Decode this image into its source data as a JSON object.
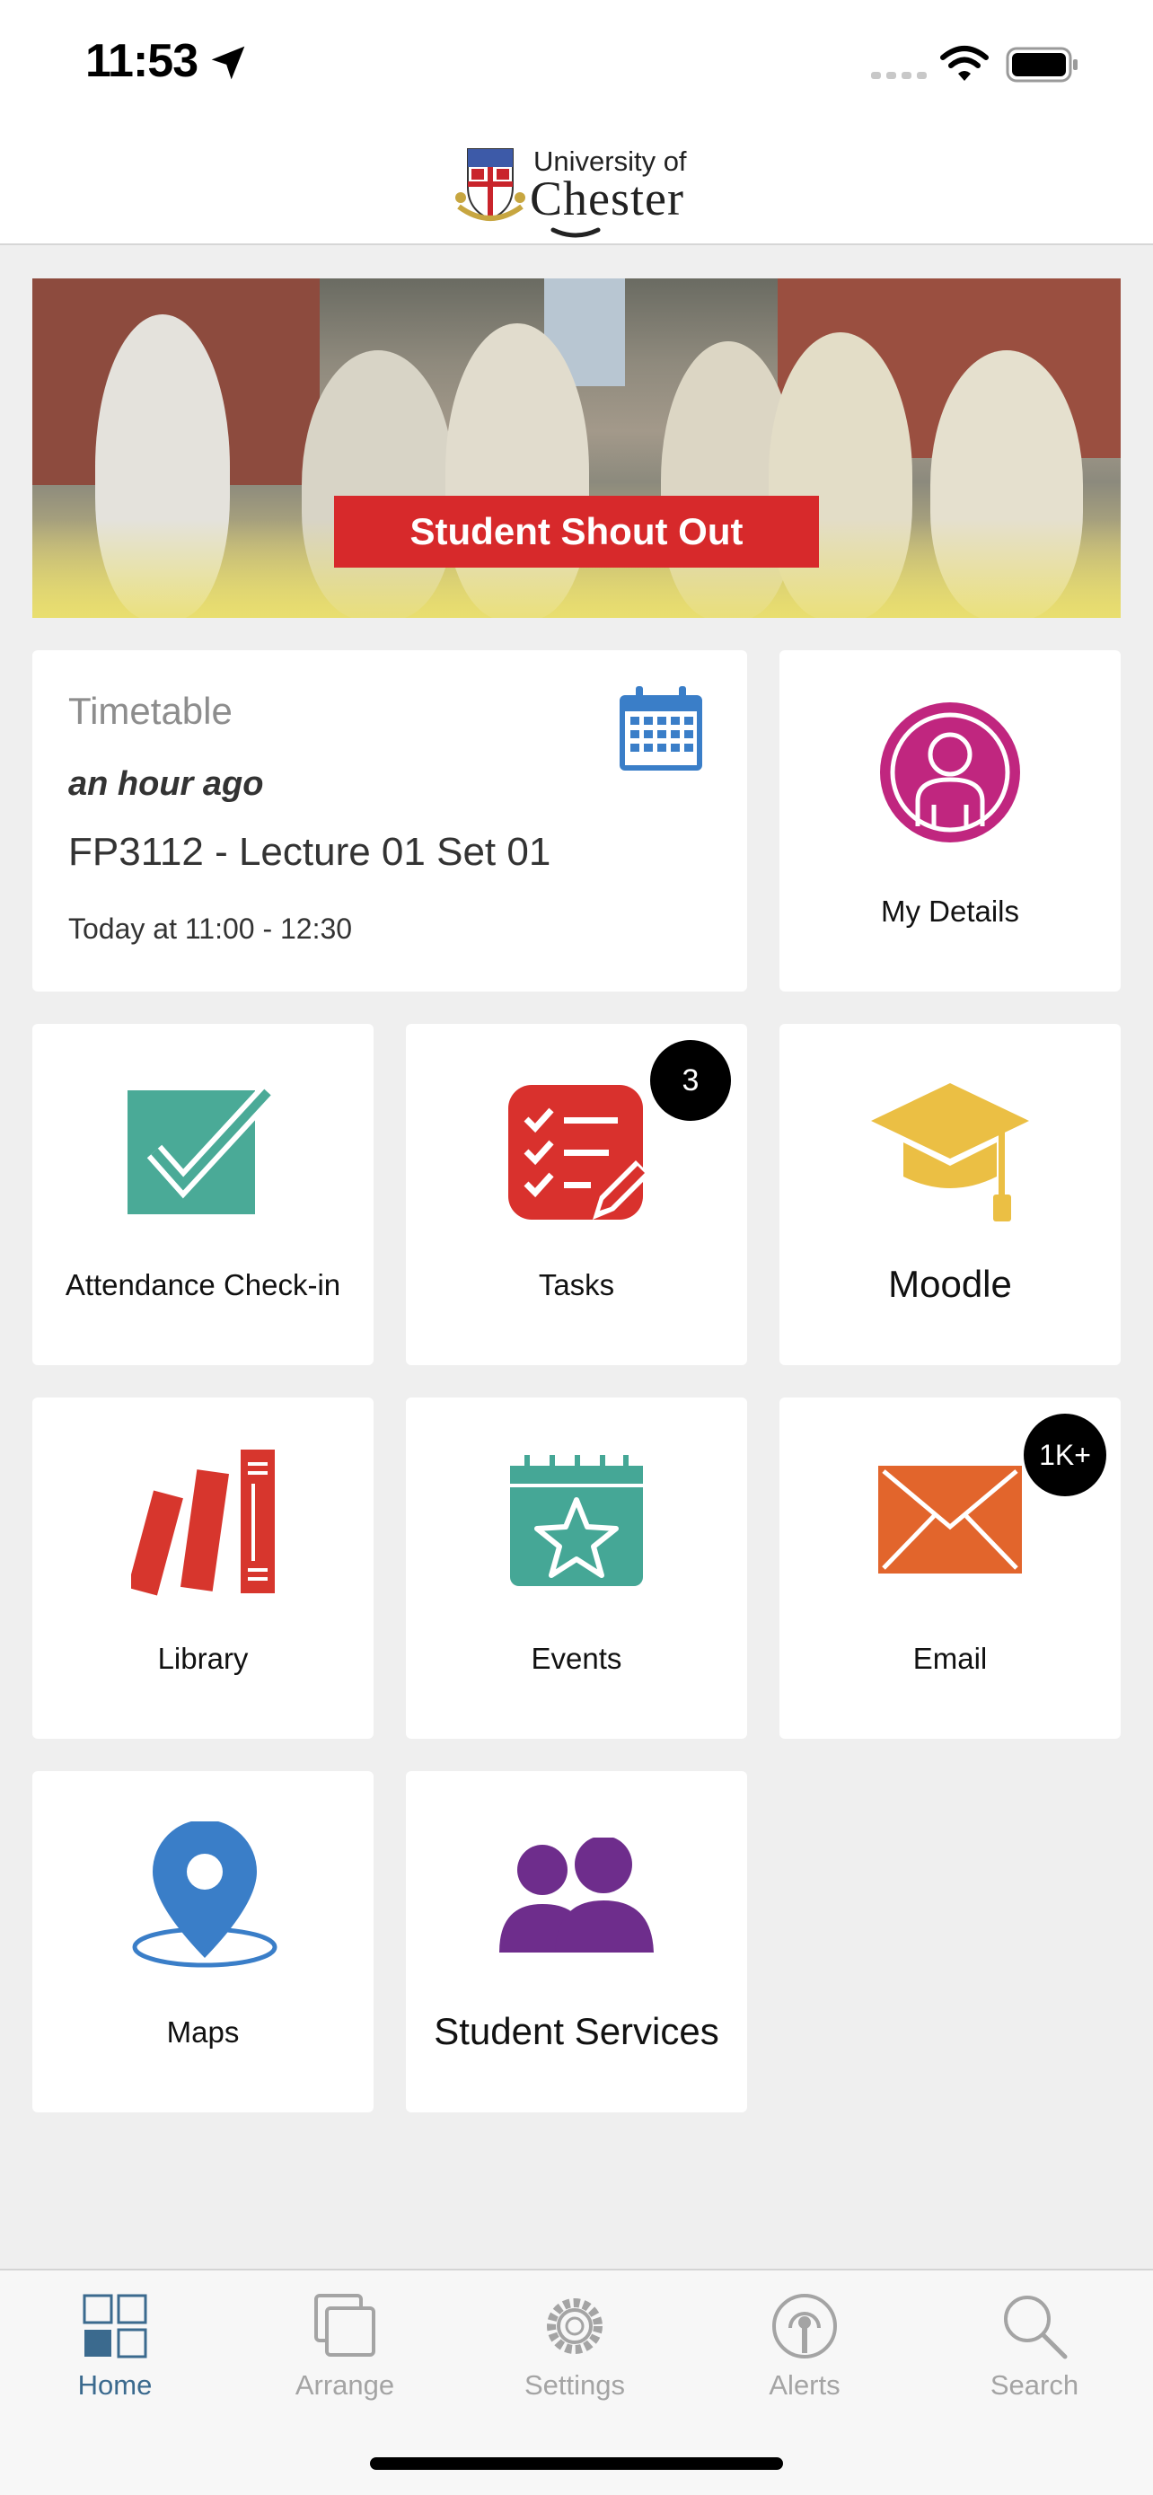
{
  "status": {
    "time": "11:53",
    "icons": [
      "location-arrow-icon",
      "cellular-signal-icon",
      "wifi-icon",
      "battery-icon"
    ]
  },
  "header": {
    "logo_line1": "University of",
    "logo_line2": "Chester"
  },
  "banner": {
    "label": "Student Shout Out"
  },
  "timetable": {
    "title": "Timetable",
    "relative_time": "an hour ago",
    "course": "FP3112 - Lecture 01 Set 01",
    "when": "Today at 11:00 - 12:30",
    "icon": "calendar-icon"
  },
  "tiles": {
    "my_details": {
      "label": "My Details",
      "icon": "user-profile-icon",
      "color": "#c0267f"
    },
    "attendance": {
      "label": "Attendance Check-in",
      "icon": "checkmark-icon",
      "color": "#4aaa97"
    },
    "tasks": {
      "label": "Tasks",
      "icon": "task-list-icon",
      "color": "#d9312d",
      "badge": "3"
    },
    "moodle": {
      "label": "Moodle",
      "icon": "graduation-cap-icon",
      "color": "#ebbf44"
    },
    "library": {
      "label": "Library",
      "icon": "books-icon",
      "color": "#d7362d"
    },
    "events": {
      "label": "Events",
      "icon": "calendar-star-icon",
      "color": "#45a796"
    },
    "email": {
      "label": "Email",
      "icon": "envelope-icon",
      "color": "#e2652c",
      "badge": "1K+"
    },
    "maps": {
      "label": "Maps",
      "icon": "map-pin-icon",
      "color": "#3a7ec8"
    },
    "student_services": {
      "label": "Student Services",
      "icon": "people-icon",
      "color": "#6e2d8c"
    }
  },
  "tabbar": {
    "tabs": [
      {
        "label": "Home",
        "icon": "home-grid-icon",
        "active": true
      },
      {
        "label": "Arrange",
        "icon": "arrange-icon",
        "active": false
      },
      {
        "label": "Settings",
        "icon": "gear-icon",
        "active": false
      },
      {
        "label": "Alerts",
        "icon": "broadcast-icon",
        "active": false
      },
      {
        "label": "Search",
        "icon": "search-icon",
        "active": false
      }
    ],
    "active_color": "#3b6a8e",
    "inactive_color": "#a4a4a4"
  }
}
